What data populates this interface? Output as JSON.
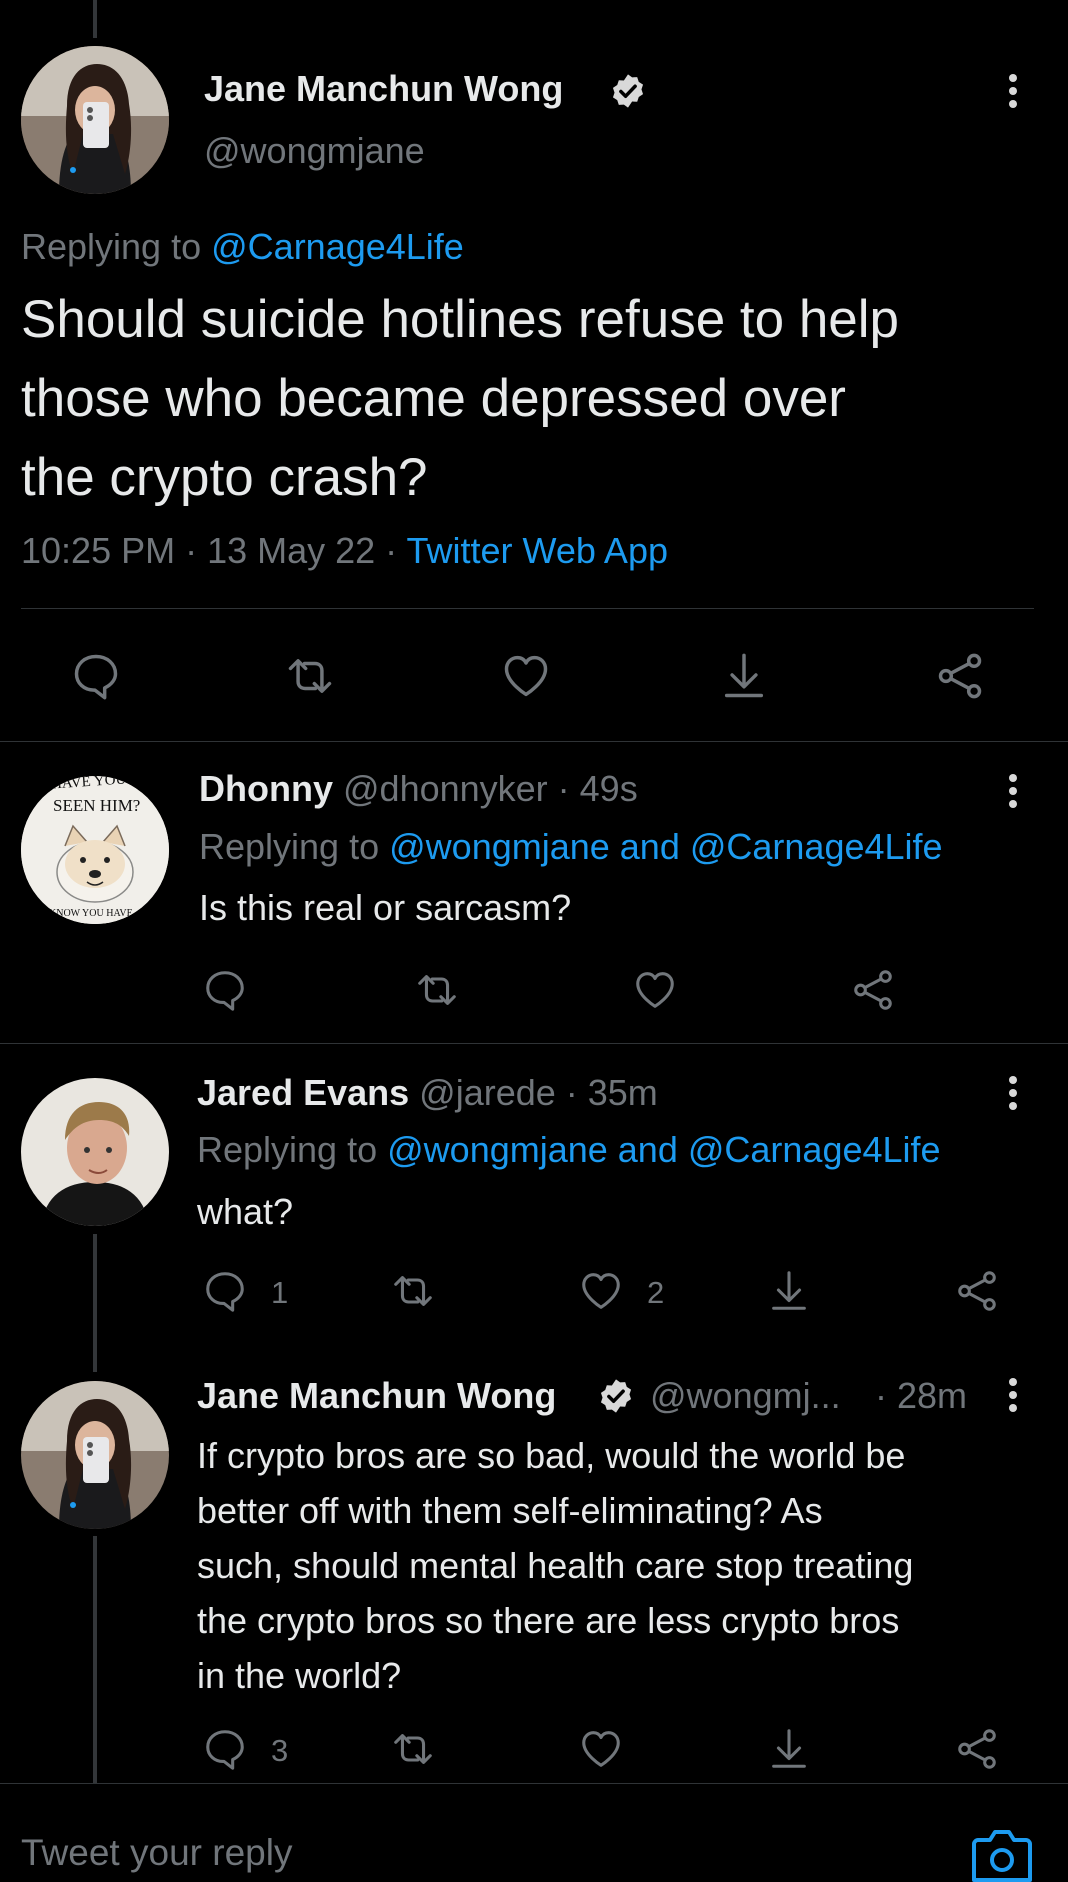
{
  "main_tweet": {
    "author_name": "Jane Manchun Wong",
    "handle": "@wongmjane",
    "replying_prefix": "Replying to",
    "replying_to": "@Carnage4Life",
    "text_line1": "Should suicide hotlines refuse to help",
    "text_line2": "those who became depressed over",
    "text_line3": "the crypto crash?",
    "meta": "10:25 PM · 13 May 22 ·",
    "source": "Twitter Web App"
  },
  "replies": [
    {
      "name": "Dhonny",
      "handle_time": "@dhonnyker · 49s",
      "replying_prefix": "Replying to",
      "replying_to": "@wongmjane and @Carnage4Life",
      "text": "Is this real or sarcasm?",
      "avatar_sign_top": "HAVE YOU",
      "avatar_sign_mid": "SEEN HIM?",
      "avatar_sign_bottom": "KNOW YOU HAVE"
    },
    {
      "name": "Jared Evans",
      "handle_time": "@jarede · 35m",
      "replying_prefix": "Replying to",
      "replying_to": "@wongmjane and @Carnage4Life",
      "text": "what?",
      "reply_count": "1",
      "like_count": "2"
    },
    {
      "name": "Jane Manchun Wong",
      "handle": "@wongmj...",
      "time": "· 28m",
      "text_line1": "If crypto bros are so bad, would the world be",
      "text_line2": "better off with them self-eliminating? As",
      "text_line3": "such, should mental health care stop treating",
      "text_line4": "the crypto bros so there are less crypto bros",
      "text_line5": "in the world?",
      "reply_count": "3"
    }
  ],
  "reply_bar": {
    "placeholder": "Tweet your reply"
  },
  "colors": {
    "background": "#000000",
    "text": "#e7e9ea",
    "muted": "#71767b",
    "link": "#1d9bf0",
    "divider": "#2f3336"
  },
  "icons": [
    "reply-icon",
    "retweet-icon",
    "like-icon",
    "bookmark-icon",
    "share-icon",
    "more-icon",
    "verified-icon",
    "camera-icon"
  ]
}
